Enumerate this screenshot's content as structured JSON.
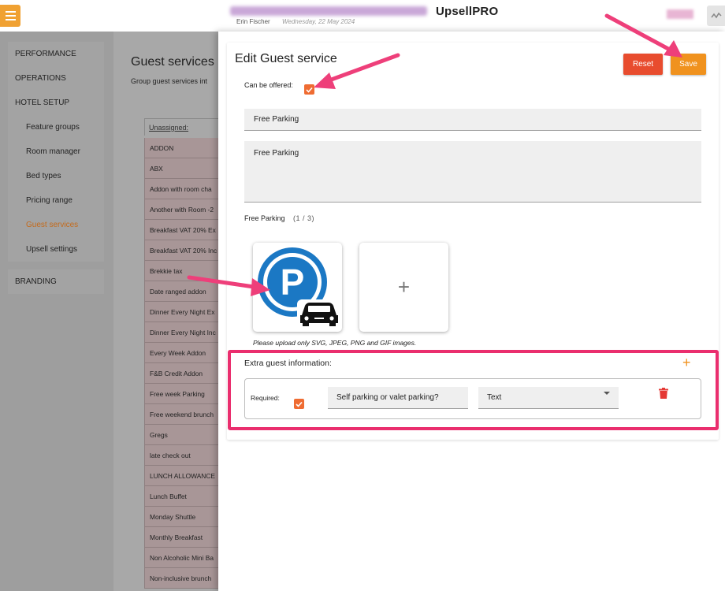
{
  "header": {
    "app_title": "UpsellPRO",
    "user_name": "Erin Fischer",
    "date": "Wednesday, 22 May 2024"
  },
  "sidebar": {
    "performance": "PERFORMANCE",
    "operations": "OPERATIONS",
    "hotel_setup": "HOTEL SETUP",
    "hotel_setup_items": [
      {
        "label": "Feature groups"
      },
      {
        "label": "Room manager"
      },
      {
        "label": "Bed types"
      },
      {
        "label": "Pricing range"
      },
      {
        "label": "Guest services",
        "active": true
      },
      {
        "label": "Upsell settings"
      }
    ],
    "branding": "BRANDING"
  },
  "background_page": {
    "title": "Guest services",
    "subtitle": "Group guest services int",
    "list_header": "Unassigned:",
    "list_items": [
      "ADDON",
      "ABX",
      "Addon with room cha",
      "Another with Room -2",
      "Breakfast VAT 20% Ex",
      "Breakfast VAT 20% Inc",
      "Brekkie tax",
      "Date ranged addon",
      "Dinner Every Night Ex",
      "Dinner Every Night Inc",
      "Every Week Addon",
      "F&B Credit Addon",
      "Free week Parking",
      "Free weekend brunch",
      "Gregs",
      "late check out",
      "LUNCH ALLOWANCE",
      "Lunch Buffet",
      "Monday Shuttle",
      "Monthly Breakfast",
      "Non Alcoholic Mini Ba",
      "Non-inclusive brunch"
    ]
  },
  "edit_panel": {
    "title": "Edit Guest service",
    "reset_label": "Reset",
    "save_label": "Save",
    "can_be_offered_label": "Can be offered:",
    "can_be_offered": true,
    "name_value": "Free Parking",
    "description_value": "Free Parking",
    "image_caption": "Free Parking",
    "image_count": "(1 / 3)",
    "add_image_symbol": "+",
    "upload_hint": "Please upload only SVG, JPEG, PNG and GIF images.",
    "parking_icon": "parking-car-icon",
    "extra_info": {
      "title": "Extra guest information:",
      "add_symbol": "+",
      "required_label": "Required:",
      "required": true,
      "question_value": "Self parking or valet parking?",
      "type_value": "Text"
    }
  },
  "colors": {
    "accent_orange": "#f0921e",
    "reset_red": "#e84c2e",
    "checkbox_orange": "#ef6c32",
    "highlight_pink": "#ea2e6e",
    "delete_red": "#e53935"
  }
}
